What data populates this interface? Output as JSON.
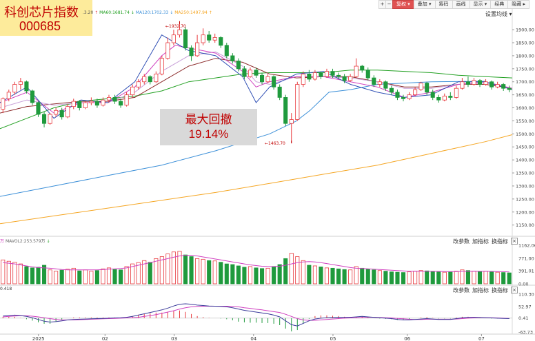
{
  "toolbar": {
    "buttons": [
      {
        "label": "+"
      },
      {
        "label": "−"
      },
      {
        "label": "复权 ▾",
        "active": true
      },
      {
        "label": "叠加 ▾"
      },
      {
        "label": "筹码"
      },
      {
        "label": "画线"
      },
      {
        "label": "显示 ▾"
      },
      {
        "label": "经典"
      },
      {
        "label": "隐藏 ▸"
      }
    ]
  },
  "title": {
    "name": "科创芯片指数",
    "code": "000685"
  },
  "drawdown": {
    "label": "最大回撤",
    "value": "19.14%"
  },
  "settings_link": "设置均线 ▾",
  "legend": {
    "ma1": ".3.20",
    "ma60": "MA60:1681.74",
    "ma120": "MA120:1702.33",
    "ma250": "MA250:1497.94"
  },
  "high_label": "1932.70",
  "low_label": "1463.70",
  "vol_legend": "MAVOL2:253.579万",
  "vol_unit": "万",
  "macd_legend": "0.418",
  "sub_links": {
    "change_params": "改参数",
    "add_indicator": "加指标",
    "switch_indicator": "换指标",
    "close": "×"
  },
  "colors": {
    "up": "#e8393d",
    "down": "#1f9a3d",
    "ma5": "#3050b5",
    "ma10": "#d040c0",
    "ma20": "#c8a0d8",
    "ma30": "#8b2a2a",
    "ma60": "#22a022",
    "ma120": "#3b8fd8",
    "ma250": "#f5a623",
    "dif": "#3a3a9a",
    "dea": "#d040c0"
  },
  "chart_data": {
    "type": "candlestick",
    "price_axis": {
      "ticks": [
        "1900.00",
        "1850.00",
        "1800.00",
        "1750.00",
        "1700.00",
        "1650.00",
        "1600.00",
        "1550.00",
        "1500.00",
        "1450.00",
        "1400.00",
        "1350.00",
        "1300.00",
        "1250.00",
        "1200.00",
        "1150.00"
      ],
      "range": [
        1120,
        1940
      ]
    },
    "volume_axis": {
      "ticks": [
        "1162.06",
        "771.00",
        "391.01",
        "0.00"
      ],
      "range": [
        0,
        1162.06
      ]
    },
    "macd_axis": {
      "ticks": [
        "110.30",
        "52.97",
        "0.41",
        "-63.73"
      ],
      "range": [
        -63.73,
        110.3
      ]
    },
    "x_ticks": [
      "2025",
      "02",
      "03",
      "04",
      "05",
      "06",
      "07"
    ],
    "ma120_path": [
      [
        0,
        1260
      ],
      [
        20,
        1300
      ],
      [
        40,
        1340
      ],
      [
        60,
        1380
      ],
      [
        80,
        1435
      ],
      [
        100,
        1500
      ],
      [
        110,
        1550
      ],
      [
        115,
        1590
      ],
      [
        118,
        1620
      ],
      [
        122,
        1660
      ],
      [
        130,
        1670
      ],
      [
        140,
        1690
      ],
      [
        160,
        1700
      ],
      [
        180,
        1702
      ]
    ],
    "ma250_path": [
      [
        0,
        1155
      ],
      [
        20,
        1185
      ],
      [
        40,
        1215
      ],
      [
        60,
        1245
      ],
      [
        80,
        1275
      ],
      [
        100,
        1310
      ],
      [
        120,
        1345
      ],
      [
        140,
        1380
      ],
      [
        160,
        1425
      ],
      [
        180,
        1470
      ],
      [
        190,
        1497
      ]
    ],
    "ma60_path": [
      [
        0,
        1520
      ],
      [
        10,
        1560
      ],
      [
        20,
        1600
      ],
      [
        30,
        1625
      ],
      [
        40,
        1635
      ],
      [
        50,
        1645
      ],
      [
        60,
        1665
      ],
      [
        70,
        1700
      ],
      [
        80,
        1715
      ],
      [
        90,
        1730
      ],
      [
        100,
        1735
      ],
      [
        120,
        1735
      ],
      [
        130,
        1745
      ],
      [
        140,
        1745
      ],
      [
        160,
        1735
      ],
      [
        170,
        1725
      ],
      [
        180,
        1720
      ],
      [
        190,
        1715
      ]
    ],
    "ma30_path": [
      [
        0,
        1580
      ],
      [
        10,
        1605
      ],
      [
        20,
        1615
      ],
      [
        30,
        1625
      ],
      [
        40,
        1625
      ],
      [
        50,
        1640
      ],
      [
        60,
        1700
      ],
      [
        70,
        1760
      ],
      [
        80,
        1790
      ],
      [
        90,
        1775
      ],
      [
        100,
        1730
      ],
      [
        110,
        1715
      ],
      [
        120,
        1720
      ],
      [
        130,
        1720
      ],
      [
        140,
        1700
      ],
      [
        150,
        1680
      ],
      [
        160,
        1680
      ],
      [
        170,
        1690
      ],
      [
        180,
        1690
      ],
      [
        190,
        1675
      ]
    ],
    "ma20_path": [
      [
        0,
        1600
      ],
      [
        10,
        1630
      ],
      [
        20,
        1610
      ],
      [
        30,
        1620
      ],
      [
        40,
        1620
      ],
      [
        50,
        1660
      ],
      [
        60,
        1740
      ],
      [
        70,
        1800
      ],
      [
        80,
        1815
      ],
      [
        90,
        1760
      ],
      [
        95,
        1700
      ],
      [
        100,
        1690
      ],
      [
        110,
        1720
      ],
      [
        120,
        1720
      ],
      [
        130,
        1715
      ],
      [
        140,
        1700
      ],
      [
        150,
        1675
      ],
      [
        160,
        1675
      ],
      [
        170,
        1690
      ],
      [
        180,
        1695
      ],
      [
        190,
        1675
      ]
    ],
    "ma10_path": [
      [
        0,
        1620
      ],
      [
        10,
        1660
      ],
      [
        20,
        1580
      ],
      [
        30,
        1620
      ],
      [
        40,
        1620
      ],
      [
        50,
        1680
      ],
      [
        60,
        1800
      ],
      [
        65,
        1840
      ],
      [
        70,
        1830
      ],
      [
        80,
        1810
      ],
      [
        90,
        1740
      ],
      [
        95,
        1680
      ],
      [
        100,
        1700
      ],
      [
        110,
        1720
      ],
      [
        120,
        1720
      ],
      [
        130,
        1700
      ],
      [
        140,
        1680
      ],
      [
        150,
        1640
      ],
      [
        160,
        1660
      ],
      [
        170,
        1690
      ],
      [
        180,
        1700
      ],
      [
        190,
        1675
      ]
    ],
    "ma5_path": [
      [
        0,
        1620
      ],
      [
        10,
        1680
      ],
      [
        20,
        1560
      ],
      [
        30,
        1630
      ],
      [
        40,
        1620
      ],
      [
        50,
        1700
      ],
      [
        60,
        1880
      ],
      [
        70,
        1820
      ],
      [
        80,
        1800
      ],
      [
        90,
        1720
      ],
      [
        95,
        1620
      ],
      [
        100,
        1680
      ],
      [
        110,
        1730
      ],
      [
        120,
        1740
      ],
      [
        130,
        1690
      ],
      [
        140,
        1660
      ],
      [
        150,
        1640
      ],
      [
        160,
        1650
      ],
      [
        170,
        1700
      ],
      [
        180,
        1700
      ],
      [
        190,
        1670
      ]
    ],
    "candles": [
      [
        1595,
        1635,
        1580,
        1640
      ],
      [
        1635,
        1660,
        1625,
        1670
      ],
      [
        1660,
        1690,
        1650,
        1700
      ],
      [
        1690,
        1700,
        1670,
        1715
      ],
      [
        1700,
        1665,
        1655,
        1705
      ],
      [
        1665,
        1620,
        1610,
        1670
      ],
      [
        1620,
        1575,
        1565,
        1625
      ],
      [
        1575,
        1540,
        1525,
        1585
      ],
      [
        1540,
        1575,
        1535,
        1580
      ],
      [
        1575,
        1590,
        1565,
        1600
      ],
      [
        1590,
        1565,
        1555,
        1600
      ],
      [
        1565,
        1605,
        1560,
        1615
      ],
      [
        1605,
        1625,
        1595,
        1635
      ],
      [
        1625,
        1600,
        1590,
        1630
      ],
      [
        1600,
        1620,
        1595,
        1625
      ],
      [
        1620,
        1625,
        1610,
        1640
      ],
      [
        1625,
        1610,
        1600,
        1635
      ],
      [
        1610,
        1630,
        1605,
        1640
      ],
      [
        1630,
        1640,
        1620,
        1650
      ],
      [
        1640,
        1625,
        1615,
        1650
      ],
      [
        1625,
        1610,
        1600,
        1635
      ],
      [
        1610,
        1650,
        1605,
        1660
      ],
      [
        1650,
        1680,
        1640,
        1690
      ],
      [
        1680,
        1700,
        1670,
        1710
      ],
      [
        1700,
        1720,
        1690,
        1730
      ],
      [
        1720,
        1700,
        1690,
        1725
      ],
      [
        1700,
        1730,
        1695,
        1740
      ],
      [
        1730,
        1790,
        1725,
        1800
      ],
      [
        1790,
        1850,
        1785,
        1870
      ],
      [
        1850,
        1880,
        1840,
        1900
      ],
      [
        1880,
        1900,
        1870,
        1932.7
      ],
      [
        1900,
        1830,
        1820,
        1910
      ],
      [
        1830,
        1800,
        1780,
        1840
      ],
      [
        1800,
        1850,
        1795,
        1880
      ],
      [
        1850,
        1880,
        1840,
        1905
      ],
      [
        1880,
        1860,
        1850,
        1895
      ],
      [
        1860,
        1870,
        1850,
        1885
      ],
      [
        1870,
        1840,
        1830,
        1875
      ],
      [
        1840,
        1800,
        1790,
        1850
      ],
      [
        1800,
        1780,
        1770,
        1810
      ],
      [
        1780,
        1750,
        1740,
        1790
      ],
      [
        1750,
        1720,
        1710,
        1760
      ],
      [
        1720,
        1745,
        1715,
        1755
      ],
      [
        1745,
        1725,
        1715,
        1755
      ],
      [
        1725,
        1700,
        1690,
        1735
      ],
      [
        1700,
        1720,
        1695,
        1730
      ],
      [
        1720,
        1680,
        1670,
        1725
      ],
      [
        1680,
        1640,
        1630,
        1690
      ],
      [
        1640,
        1540,
        1530,
        1650
      ],
      [
        1540,
        1555,
        1463.7,
        1580
      ],
      [
        1555,
        1690,
        1550,
        1700
      ],
      [
        1690,
        1730,
        1680,
        1740
      ],
      [
        1730,
        1710,
        1700,
        1745
      ],
      [
        1710,
        1735,
        1705,
        1745
      ],
      [
        1735,
        1720,
        1710,
        1740
      ],
      [
        1720,
        1740,
        1715,
        1750
      ],
      [
        1740,
        1725,
        1715,
        1750
      ],
      [
        1725,
        1720,
        1710,
        1735
      ],
      [
        1720,
        1705,
        1695,
        1730
      ],
      [
        1705,
        1720,
        1700,
        1730
      ],
      [
        1720,
        1760,
        1715,
        1790
      ],
      [
        1760,
        1745,
        1735,
        1765
      ],
      [
        1745,
        1715,
        1705,
        1755
      ],
      [
        1715,
        1690,
        1680,
        1725
      ],
      [
        1690,
        1700,
        1680,
        1710
      ],
      [
        1700,
        1675,
        1665,
        1705
      ],
      [
        1675,
        1660,
        1650,
        1685
      ],
      [
        1660,
        1640,
        1630,
        1670
      ],
      [
        1640,
        1635,
        1625,
        1650
      ],
      [
        1635,
        1650,
        1630,
        1660
      ],
      [
        1650,
        1670,
        1645,
        1680
      ],
      [
        1670,
        1695,
        1665,
        1700
      ],
      [
        1695,
        1660,
        1650,
        1700
      ],
      [
        1660,
        1640,
        1630,
        1670
      ],
      [
        1640,
        1630,
        1620,
        1650
      ],
      [
        1630,
        1645,
        1625,
        1655
      ],
      [
        1645,
        1640,
        1630,
        1660
      ],
      [
        1640,
        1675,
        1635,
        1685
      ],
      [
        1675,
        1700,
        1670,
        1715
      ],
      [
        1700,
        1690,
        1680,
        1720
      ],
      [
        1690,
        1705,
        1685,
        1715
      ],
      [
        1705,
        1690,
        1680,
        1710
      ],
      [
        1690,
        1700,
        1685,
        1710
      ],
      [
        1700,
        1680,
        1670,
        1705
      ],
      [
        1680,
        1690,
        1675,
        1700
      ],
      [
        1690,
        1675,
        1665,
        1695
      ],
      [
        1675,
        1670,
        1660,
        1685
      ]
    ],
    "volumes": [
      720,
      680,
      650,
      600,
      520,
      480,
      500,
      560,
      420,
      380,
      410,
      440,
      470,
      390,
      420,
      380,
      400,
      450,
      480,
      430,
      420,
      520,
      600,
      640,
      700,
      650,
      760,
      820,
      900,
      960,
      980,
      870,
      820,
      760,
      740,
      700,
      690,
      650,
      600,
      580,
      540,
      500,
      520,
      480,
      460,
      470,
      520,
      580,
      760,
      920,
      820,
      700,
      560,
      540,
      510,
      480,
      470,
      450,
      430,
      420,
      520,
      470,
      440,
      420,
      400,
      380,
      360,
      350,
      340,
      360,
      380,
      400,
      390,
      370,
      360,
      350,
      360,
      380,
      420,
      400,
      380,
      370,
      380,
      360,
      350,
      340,
      330
    ],
    "vol_ma": [
      640,
      620,
      600,
      570,
      540,
      510,
      490,
      480,
      470,
      450,
      430,
      420,
      420,
      420,
      420,
      420,
      420,
      430,
      440,
      450,
      460,
      480,
      520,
      560,
      600,
      640,
      680,
      720,
      760,
      800,
      840,
      860,
      860,
      840,
      810,
      780,
      750,
      720,
      690,
      660,
      630,
      600,
      570,
      550,
      530,
      520,
      520,
      530,
      560,
      600,
      640,
      660,
      670,
      660,
      640,
      610,
      580,
      550,
      520,
      490,
      470,
      460,
      450,
      440,
      430,
      420,
      410,
      400,
      390,
      380,
      380,
      380,
      380,
      380,
      375,
      370,
      370,
      370,
      375,
      380,
      382,
      380,
      378,
      375,
      370,
      365,
      360
    ],
    "macd": {
      "dif": [
        10,
        12,
        14,
        12,
        8,
        2,
        -6,
        -14,
        -18,
        -16,
        -12,
        -8,
        -6,
        -5,
        -4,
        -3,
        -2,
        -1,
        0,
        1,
        2,
        4,
        8,
        14,
        20,
        26,
        32,
        38,
        46,
        56,
        64,
        66,
        64,
        60,
        58,
        56,
        55,
        54,
        52,
        48,
        42,
        36,
        32,
        28,
        24,
        20,
        14,
        6,
        -12,
        -30,
        -36,
        -24,
        -12,
        -4,
        0,
        2,
        3,
        4,
        4,
        4,
        6,
        8,
        6,
        4,
        2,
        0,
        -2,
        -6,
        -8,
        -8,
        -6,
        -4,
        -2,
        -4,
        -6,
        -6,
        -6,
        -2,
        2,
        4,
        4,
        3,
        2,
        1,
        0,
        -1,
        -2
      ],
      "dea": [
        6,
        8,
        10,
        11,
        11,
        9,
        6,
        2,
        -2,
        -6,
        -8,
        -8,
        -8,
        -7,
        -6,
        -5,
        -4,
        -3,
        -2,
        -1,
        0,
        1,
        2,
        4,
        8,
        12,
        16,
        22,
        28,
        34,
        42,
        48,
        52,
        54,
        55,
        55,
        55,
        55,
        55,
        54,
        52,
        48,
        45,
        41,
        38,
        34,
        30,
        26,
        18,
        8,
        -2,
        -8,
        -10,
        -10,
        -8,
        -6,
        -4,
        -2,
        0,
        1,
        2,
        3,
        4,
        4,
        3,
        2,
        1,
        -1,
        -3,
        -5,
        -6,
        -6,
        -5,
        -5,
        -5,
        -5,
        -5,
        -4,
        -2,
        0,
        1,
        2,
        2,
        2,
        1,
        0,
        -1
      ]
    }
  }
}
